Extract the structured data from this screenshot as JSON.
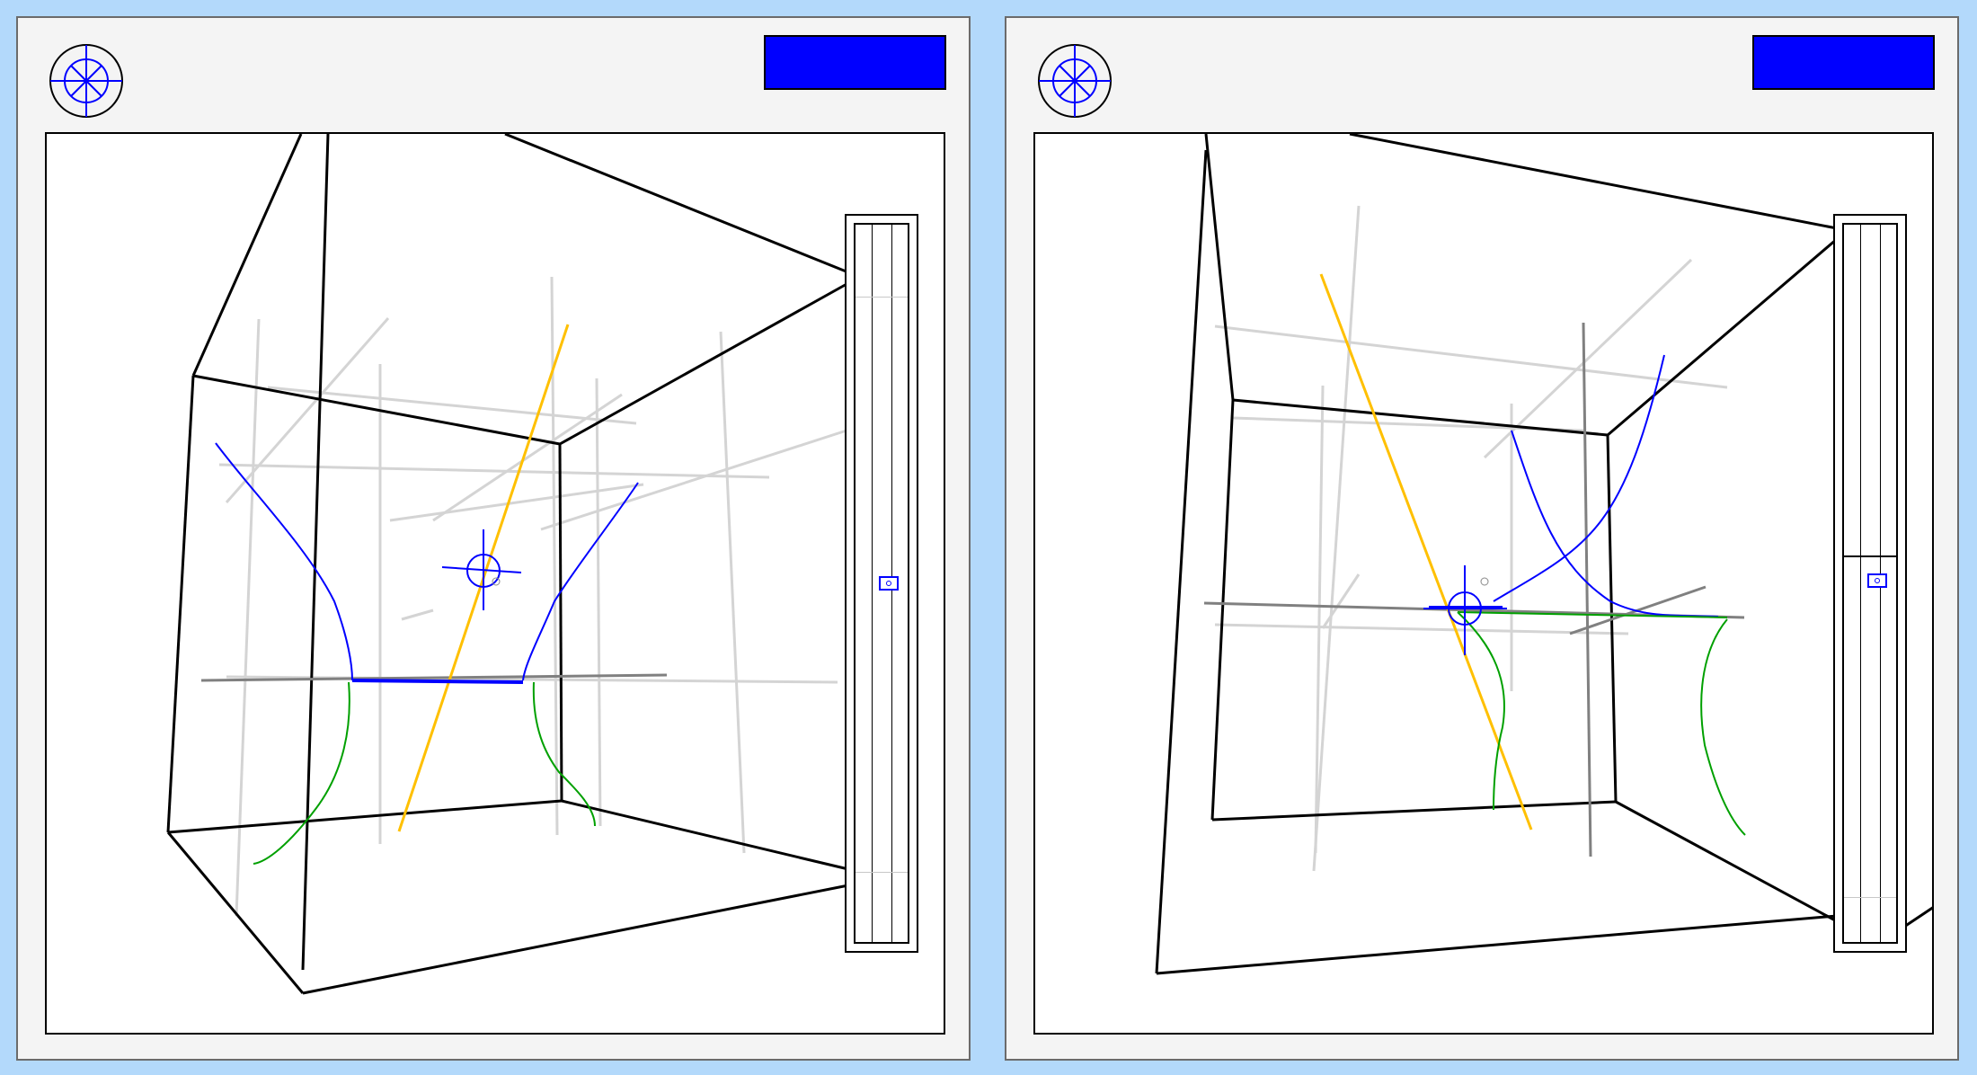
{
  "app": {
    "panels": [
      {
        "id": "left",
        "compass_icon": "compass-rose-icon",
        "mode_button": {
          "label": "",
          "color": "#0000ff"
        },
        "slider": {
          "value": 0.5
        }
      },
      {
        "id": "right",
        "compass_icon": "compass-rose-icon",
        "mode_button": {
          "label": "",
          "color": "#0000ff"
        },
        "slider": {
          "value": 0.5
        }
      }
    ]
  },
  "colors": {
    "background": "#b3d9fb",
    "panel": "#f4f4f4",
    "accent": "#0000ff",
    "curve_green": "#00a000",
    "guide_yellow": "#ffc000",
    "grid_grey": "#d4d4d4"
  }
}
